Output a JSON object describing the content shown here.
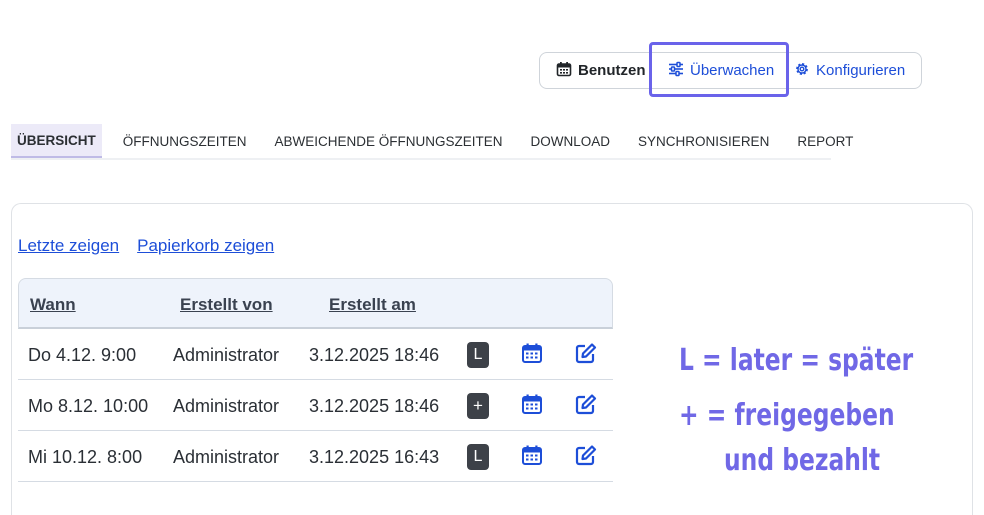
{
  "modes": {
    "use_label": "Benutzen",
    "watch_label": "Überwachen",
    "config_label": "Konfigurieren"
  },
  "tabs": [
    {
      "label": "ÜBERSICHT",
      "active": true
    },
    {
      "label": "ÖFFNUNGSZEITEN"
    },
    {
      "label": "ABWEICHENDE ÖFFNUNGSZEITEN"
    },
    {
      "label": "DOWNLOAD"
    },
    {
      "label": "SYNCHRONISIEREN"
    },
    {
      "label": "REPORT"
    }
  ],
  "links": {
    "show_recent": "Letzte zeigen",
    "show_trash": "Papierkorb zeigen"
  },
  "table": {
    "headers": [
      "Wann",
      "Erstellt von",
      "Erstellt am"
    ],
    "rows": [
      {
        "when": "Do 4.12. 9:00",
        "created_by": "Administrator",
        "created_at": "3.12.2025 18:46",
        "badge": "L"
      },
      {
        "when": "Mo 8.12. 10:00",
        "created_by": "Administrator",
        "created_at": "3.12.2025 18:46",
        "badge": "+"
      },
      {
        "when": "Mi 10.12. 8:00",
        "created_by": "Administrator",
        "created_at": "3.12.2025 16:43",
        "badge": "L"
      }
    ]
  },
  "annotation": {
    "line1": "L = later = später",
    "line2": "+ = freigegeben",
    "line3": "und bezahlt"
  },
  "colors": {
    "link": "#1d4ed8",
    "highlight": "#6a63ea",
    "badge": "#3d4148",
    "annotation": "#7068e6"
  },
  "icons": {
    "use": "calendar-icon",
    "watch": "sliders-icon",
    "config": "gear-icon",
    "row_calendar": "calendar-icon",
    "row_edit": "edit-icon"
  }
}
